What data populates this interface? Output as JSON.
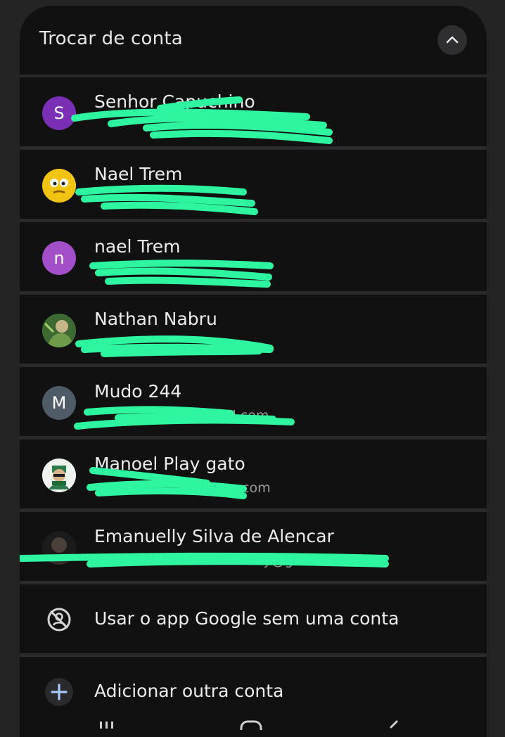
{
  "header": {
    "title": "Trocar de conta",
    "collapse_icon": "chevron-up-icon"
  },
  "accounts": [
    {
      "name": "Senhor Capuchino",
      "initial": "S",
      "avatar_color": "#7b2fb5",
      "email": ""
    },
    {
      "name": "Nael Trem",
      "initial": "",
      "avatar_color": "#e6c21a",
      "email": ""
    },
    {
      "name": "nael Trem",
      "initial": "n",
      "avatar_color": "#a24fc9",
      "email": ""
    },
    {
      "name": "Nathan Nabru",
      "initial": "",
      "avatar_color": "#5e8a4a",
      "email": ""
    },
    {
      "name": "Mudo 244",
      "initial": "M",
      "avatar_color": "#4f5b66",
      "email": "@gmail.com"
    },
    {
      "name": "Manoel Play gato",
      "initial": "",
      "avatar_color": "#e8efe9",
      "email": "com"
    },
    {
      "name": "Emanuelly Silva de Alencar",
      "initial": "",
      "avatar_color": "#1f1f1f",
      "email": "lly@gmail.co"
    }
  ],
  "actions": {
    "no_account": {
      "label": "Usar o app Google sem uma conta",
      "icon": "no-account-icon"
    },
    "add_account": {
      "label": "Adicionar outra conta",
      "icon": "plus-icon"
    }
  },
  "colors": {
    "redaction": "#2ef5a0",
    "plus_icon": "#a8c7fa"
  }
}
